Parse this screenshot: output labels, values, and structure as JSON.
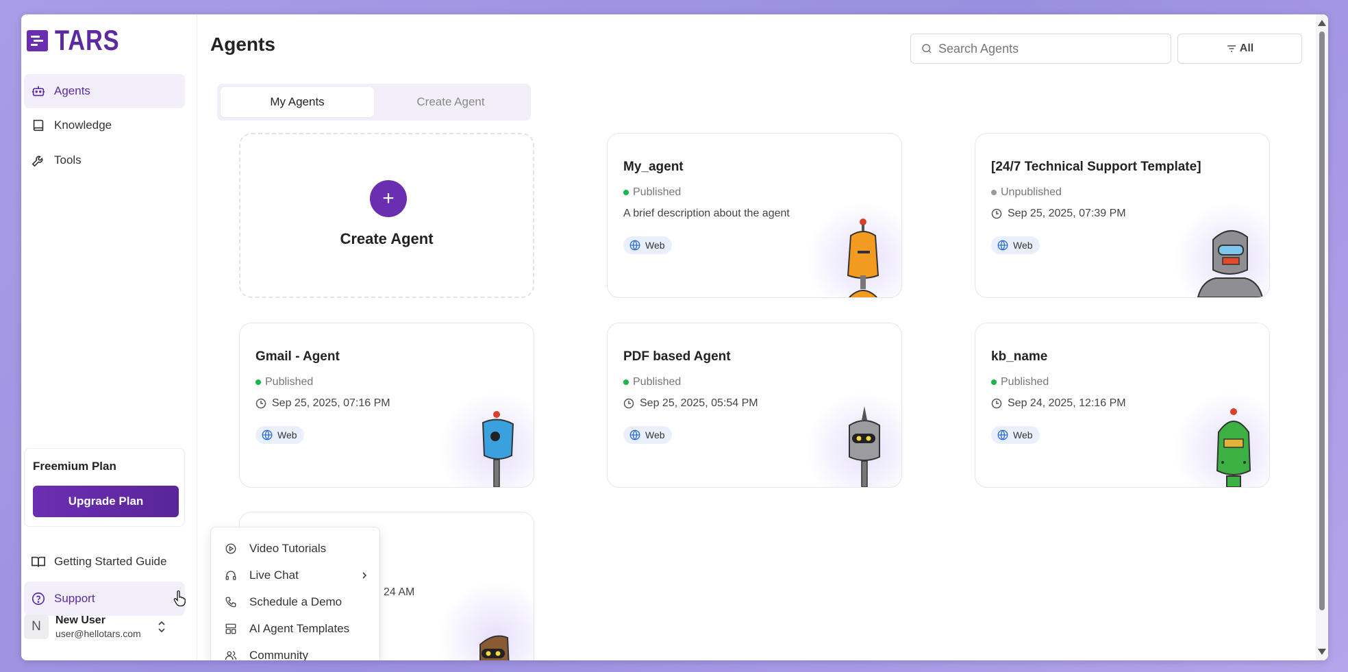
{
  "app": {
    "brand": "TARS"
  },
  "sidebar": {
    "items": [
      {
        "label": "Agents",
        "icon": "robot-icon"
      },
      {
        "label": "Knowledge",
        "icon": "book-icon"
      },
      {
        "label": "Tools",
        "icon": "wrench-icon"
      }
    ],
    "plan": {
      "title": "Freemium Plan",
      "button": "Upgrade Plan"
    },
    "bottom_items": [
      {
        "label": "Getting Started Guide",
        "icon": "open-book-icon"
      },
      {
        "label": "Support",
        "icon": "help-circle-icon"
      }
    ],
    "user": {
      "initial": "N",
      "name": "New User",
      "email": "user@hellotars.com"
    }
  },
  "main": {
    "title": "Agents",
    "search": {
      "placeholder": "Search Agents"
    },
    "filter": {
      "label": "All"
    },
    "tabs": [
      {
        "label": "My Agents"
      },
      {
        "label": "Create Agent"
      }
    ],
    "create_card": {
      "label": "Create Agent",
      "plus": "+"
    },
    "agents": [
      {
        "name": "My_agent",
        "status": "Published",
        "status_color": "#18b64c",
        "description": "A brief description about the agent",
        "channel": "Web",
        "robot_color": "#f39a21"
      },
      {
        "name": "[24/7 Technical Support Template]",
        "status": "Unpublished",
        "status_color": "#9a9a9a",
        "date": "Sep 25, 2025, 07:39 PM",
        "channel": "Web",
        "robot_color": "#8e8e93"
      },
      {
        "name": "Gmail - Agent",
        "status": "Published",
        "status_color": "#18b64c",
        "date": "Sep 25, 2025, 07:16 PM",
        "channel": "Web",
        "robot_color": "#3aa0de"
      },
      {
        "name": "PDF based Agent",
        "status": "Published",
        "status_color": "#18b64c",
        "date": "Sep 25, 2025, 05:54 PM",
        "channel": "Web",
        "robot_color": "#9b9ba0"
      },
      {
        "name": "kb_name",
        "status": "Published",
        "status_color": "#18b64c",
        "date": "Sep 24, 2025, 12:16 PM",
        "channel": "Web",
        "robot_color": "#3cb043"
      },
      {
        "date_partial": "24 AM",
        "robot_color": "#8a5a34"
      }
    ]
  },
  "support_menu": {
    "items": [
      {
        "label": "Video Tutorials",
        "icon": "play-circle-icon"
      },
      {
        "label": "Live Chat",
        "icon": "headset-icon",
        "has_submenu": true
      },
      {
        "label": "Schedule a Demo",
        "icon": "phone-icon"
      },
      {
        "label": "AI Agent Templates",
        "icon": "layout-icon"
      },
      {
        "label": "Community",
        "icon": "users-icon"
      }
    ]
  },
  "colors": {
    "brand": "#6a2fb0",
    "accent_bg": "#f2effa",
    "published": "#18b64c",
    "unpublished": "#9a9a9a"
  }
}
